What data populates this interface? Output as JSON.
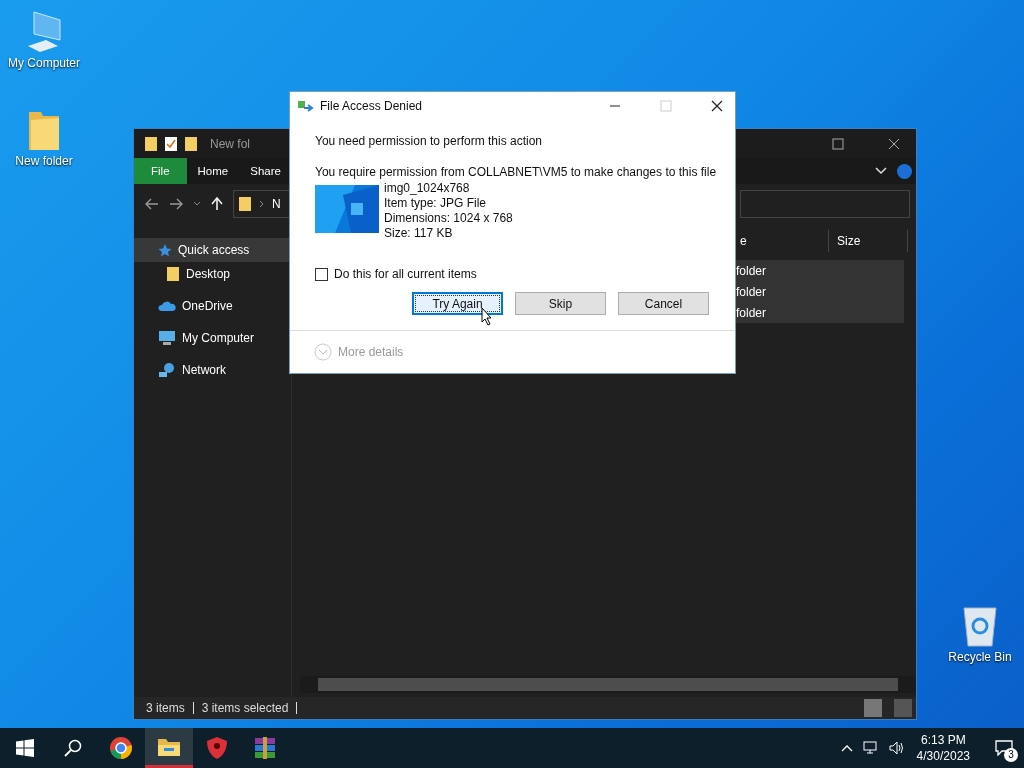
{
  "desktop_icons": [
    {
      "label": "My Computer",
      "kind": "computer"
    },
    {
      "label": "New folder",
      "kind": "folder"
    },
    {
      "label": "Recycle Bin",
      "kind": "recycle"
    }
  ],
  "explorer": {
    "title": "New fol",
    "ribbon_tabs": [
      {
        "label": "File",
        "kind": "file"
      },
      {
        "label": "Home",
        "kind": "tab"
      },
      {
        "label": "Share",
        "kind": "tab"
      }
    ],
    "address": "N",
    "sidebar": [
      {
        "label": "Quick access",
        "kind": "star",
        "selected": true,
        "children": [
          {
            "label": "Desktop",
            "kind": "folder",
            "selected": false
          }
        ]
      },
      {
        "label": "OneDrive",
        "kind": "cloud",
        "selected": false
      },
      {
        "label": "My Computer",
        "kind": "computer",
        "selected": false
      },
      {
        "label": "Network",
        "kind": "network",
        "selected": false
      }
    ],
    "columns": [
      "e",
      "Size"
    ],
    "rows": [
      {
        "column_1": "folder",
        "selected": true
      },
      {
        "column_1": "folder",
        "selected": true
      },
      {
        "column_1": "folder",
        "selected": true
      }
    ],
    "status_bar": [
      "3 items",
      "3 items selected"
    ]
  },
  "dialog": {
    "title": "File Access Denied",
    "heading": "You need permission to perform this action",
    "message": "You require permission from COLLABNET\\VM5 to make changes to this file",
    "file_name": "img0_1024x768",
    "file_details": [
      "Item type: JPG File",
      "Dimensions: 1024 x 768",
      "Size: 117 KB"
    ],
    "checkbox": {
      "label": "Do this for all current items",
      "checked": false
    },
    "buttons": [
      {
        "label": "Try Again",
        "selected": true
      },
      {
        "label": "Skip",
        "selected": false
      },
      {
        "label": "Cancel",
        "selected": false
      }
    ],
    "more_details": "More details"
  },
  "taskbar": {
    "apps": [
      {
        "kind": "chrome",
        "active": false
      },
      {
        "kind": "explorer",
        "active": true
      },
      {
        "kind": "shield",
        "active": false
      },
      {
        "kind": "archive",
        "active": false
      }
    ],
    "time": "6:13 PM",
    "date": "4/30/2023",
    "notifications": "3"
  }
}
